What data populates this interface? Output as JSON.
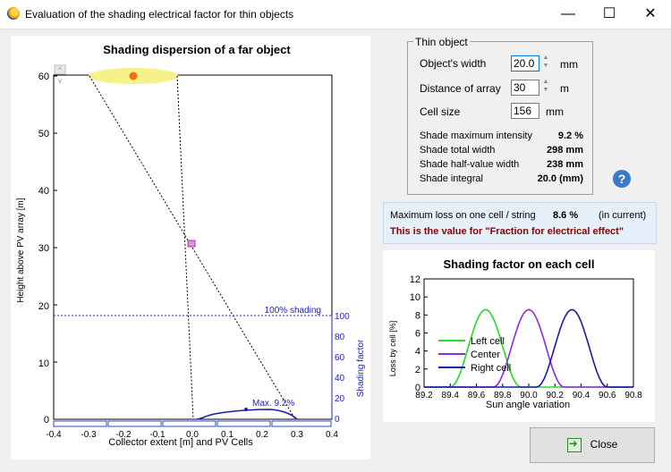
{
  "window": {
    "title": "Evaluation of the shading electrical factor for thin objects",
    "minimize": "—",
    "maximize": "☐",
    "close": "✕"
  },
  "left_chart": {
    "title": "Shading dispersion of a far object",
    "ylabel": "Height above PV array [m]",
    "xlabel": "Collector extent [m] and PV Cells",
    "y_ticks": [
      "0",
      "10",
      "20",
      "30",
      "40",
      "50",
      "60"
    ],
    "x_ticks": [
      "-0.4",
      "-0.3",
      "-0.2",
      "-0.1",
      "0.0",
      "0.1",
      "0.2",
      "0.3",
      "0.4"
    ],
    "shading_ticks": [
      "0",
      "20",
      "40",
      "60",
      "80",
      "100"
    ],
    "shading_label": "Shading factor",
    "line_100": "100% shading",
    "max_label": "Max. 9.2%"
  },
  "thin_object": {
    "legend": "Thin object",
    "width_label": "Object's width",
    "width_value": "20.0",
    "width_unit": "mm",
    "distance_label": "Distance of array",
    "distance_value": "30",
    "distance_unit": "m",
    "cell_label": "Cell size",
    "cell_value": "156",
    "cell_unit": "mm",
    "results": [
      {
        "label": "Shade maximum intensity",
        "value": "9.2 %"
      },
      {
        "label": "Shade total width",
        "value": "298 mm"
      },
      {
        "label": "Shade half-value width",
        "value": "238 mm"
      },
      {
        "label": "Shade integral",
        "value": "20.0 (mm)"
      }
    ]
  },
  "info": {
    "max_loss_label": "Maximum loss on one cell / string",
    "max_loss_value": "8.6 %",
    "max_loss_note": "(in current)",
    "fraction_note": "This is the value for \"Fraction for electrical effect\""
  },
  "close_button": "Close",
  "chart_data": {
    "type": "line",
    "title": "Shading factor on each cell",
    "xlabel": "Sun angle variation",
    "ylabel": "Loss by cell [%]",
    "xlim": [
      89.2,
      90.8
    ],
    "ylim": [
      0,
      12
    ],
    "x_ticks": [
      "89.2",
      "89.4",
      "89.6",
      "89.8",
      "90.0",
      "90.2",
      "90.4",
      "90.6",
      "90.8"
    ],
    "y_ticks": [
      "0",
      "2",
      "4",
      "6",
      "8",
      "10",
      "12"
    ],
    "legend_position": "bottom-left",
    "series": [
      {
        "name": "Left cell",
        "color": "#22dd22",
        "center": 89.67,
        "peak": 8.6,
        "half_width": 0.27
      },
      {
        "name": "Center",
        "color": "#8a2be2",
        "center": 90.0,
        "peak": 8.6,
        "half_width": 0.27
      },
      {
        "name": "Right cell",
        "color": "#1a1aaa",
        "center": 90.33,
        "peak": 8.6,
        "half_width": 0.27
      }
    ]
  }
}
